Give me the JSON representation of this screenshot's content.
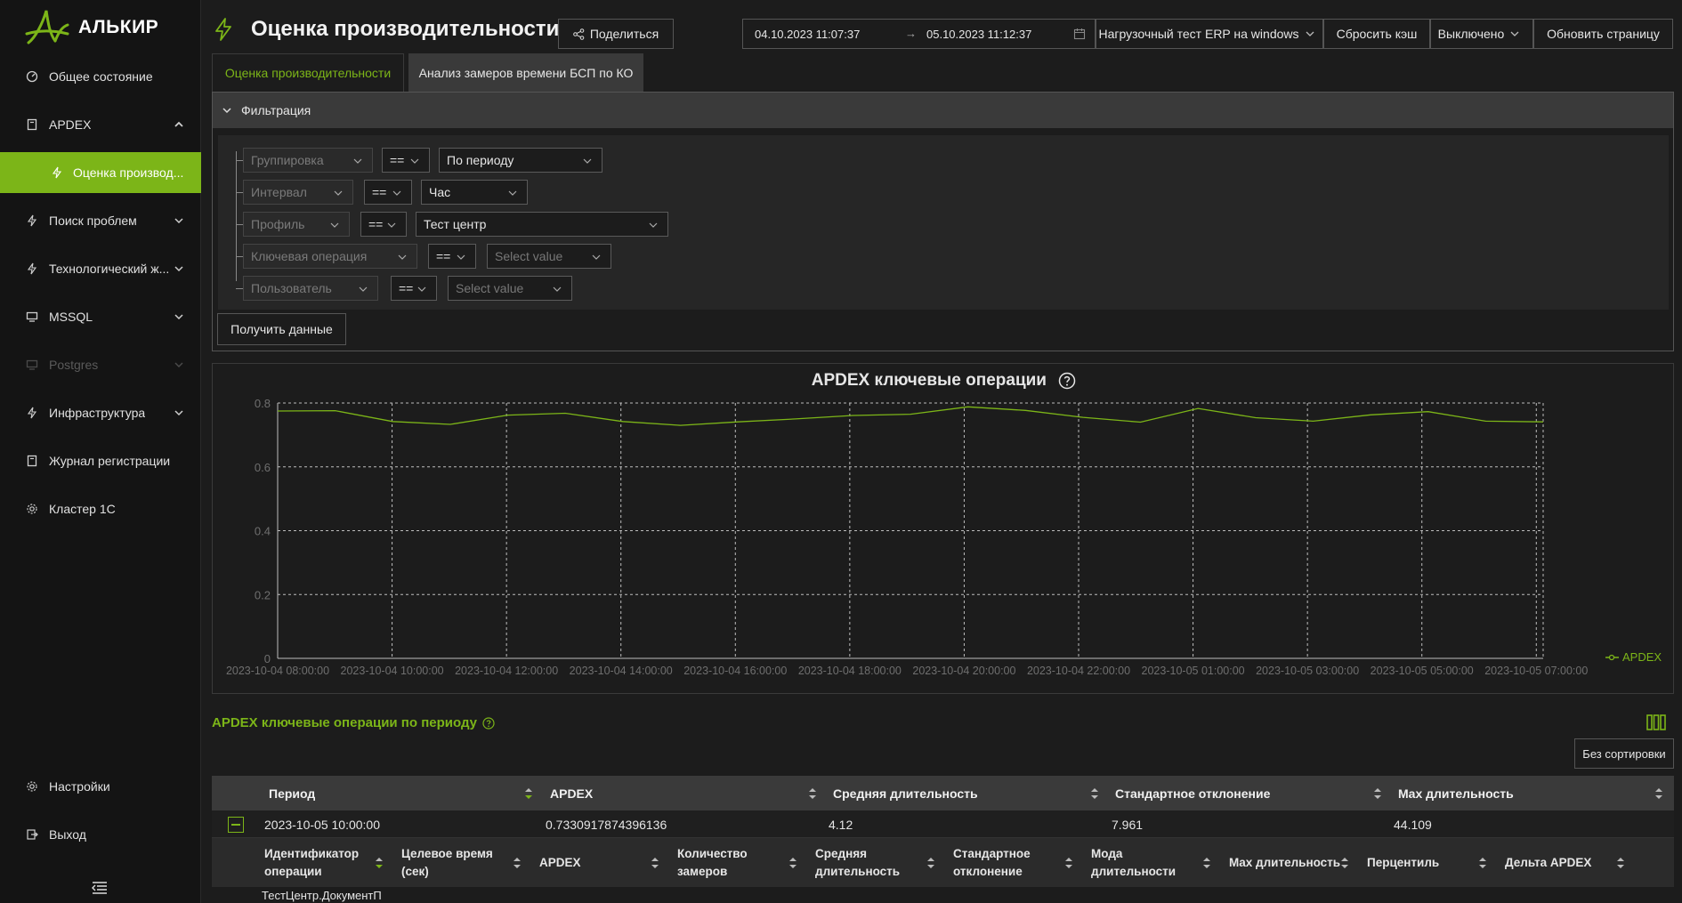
{
  "app": {
    "logo_text": "АЛЬКИР",
    "page_title": "Оценка производительности",
    "accent_color": "#7cb518",
    "background_color": "#1c1c1c"
  },
  "sidebar": {
    "items": [
      {
        "label": "Общее состояние",
        "icon": "dashboard-icon"
      },
      {
        "label": "APDEX",
        "icon": "document-icon",
        "expanded": true
      },
      {
        "label": "Оценка производ...",
        "icon": "bolt-icon",
        "active": true
      },
      {
        "label": "Поиск проблем",
        "icon": "bolt-icon"
      },
      {
        "label": "Технологический ж...",
        "icon": "bolt-icon"
      },
      {
        "label": "MSSQL",
        "icon": "monitor-icon"
      },
      {
        "label": "Postgres",
        "icon": "monitor-icon",
        "disabled": true
      },
      {
        "label": "Инфраструктура",
        "icon": "bolt-icon"
      },
      {
        "label": "Журнал регистрации",
        "icon": "document-icon"
      },
      {
        "label": "Кластер 1С",
        "icon": "gear-icon"
      }
    ],
    "bottom": [
      {
        "label": "Настройки",
        "icon": "gear-icon"
      },
      {
        "label": "Выход",
        "icon": "logout-icon"
      }
    ]
  },
  "header": {
    "share_label": "Поделиться",
    "date_from": "04.10.2023 11:07:37",
    "date_arrow": "→",
    "date_to": "05.10.2023 11:12:37",
    "profile_value": "Нагрузочный тест ERP на windows",
    "reset_cache_label": "Сбросить кэш",
    "toggle_value": "Выключено",
    "refresh_label": "Обновить страницу"
  },
  "tabs": [
    {
      "label": "Оценка производительности",
      "active": true
    },
    {
      "label": "Анализ замеров времени БСП по КО",
      "active": false
    }
  ],
  "filter": {
    "title": "Фильтрация",
    "rows": [
      {
        "field": "Группировка",
        "op": "==",
        "value": "По периоду",
        "placeholder": false
      },
      {
        "field": "Интервал",
        "op": "==",
        "value": "Час",
        "placeholder": false
      },
      {
        "field": "Профиль",
        "op": "==",
        "value": "Тест центр",
        "placeholder": false
      },
      {
        "field": "Ключевая операция",
        "op": "==",
        "value": "Select value",
        "placeholder": true
      },
      {
        "field": "Пользователь",
        "op": "==",
        "value": "Select value",
        "placeholder": true
      }
    ],
    "get_data_label": "Получить данные"
  },
  "chart_data": {
    "type": "line",
    "title": "APDEX ключевые операции",
    "xlabel": "",
    "ylabel": "",
    "ylim": [
      0,
      0.8
    ],
    "y_ticks": [
      "0",
      "0.2",
      "0.4",
      "0.6",
      "0.8"
    ],
    "x_tick_labels": [
      "2023-10-04 08:00:00",
      "2023-10-04 10:00:00",
      "2023-10-04 12:00:00",
      "2023-10-04 14:00:00",
      "2023-10-04 16:00:00",
      "2023-10-04 18:00:00",
      "2023-10-04 20:00:00",
      "2023-10-04 22:00:00",
      "2023-10-05 01:00:00",
      "2023-10-05 03:00:00",
      "2023-10-05 05:00:00",
      "2023-10-05 07:00:00"
    ],
    "grid": true,
    "legend_position": "right",
    "series": [
      {
        "name": "APDEX",
        "color": "#7cb518",
        "values": [
          0.775,
          0.776,
          0.742,
          0.733,
          0.762,
          0.768,
          0.742,
          0.73,
          0.741,
          0.75,
          0.761,
          0.765,
          0.788,
          0.777,
          0.755,
          0.74,
          0.783,
          0.754,
          0.743,
          0.763,
          0.773,
          0.743,
          0.741
        ]
      }
    ]
  },
  "table": {
    "title": "APDEX ключевые операции по периоду",
    "sort_label": "Без сортировки",
    "columns": [
      "Период",
      "APDEX",
      "Средняя длительность",
      "Стандартное отклонение",
      "Max длительность"
    ],
    "rows": [
      {
        "period": "2023-10-05 10:00:00",
        "apdex": "0.7330917874396136",
        "avg": "4.12",
        "std": "7.961",
        "max": "44.109"
      }
    ],
    "sub_columns": [
      [
        "Идентификатор",
        "операции"
      ],
      [
        "Целевое время",
        "(сек)"
      ],
      [
        "APDEX"
      ],
      [
        "Количество",
        "замеров"
      ],
      [
        "Средняя",
        "длительность"
      ],
      [
        "Стандартное",
        "отклонение"
      ],
      [
        "Мода",
        "длительности"
      ],
      [
        "Max длительность"
      ],
      [
        "Перцентиль"
      ],
      [
        "Дельта APDEX"
      ]
    ],
    "sub_row_first": "ТестЦентр.ДокументП"
  }
}
